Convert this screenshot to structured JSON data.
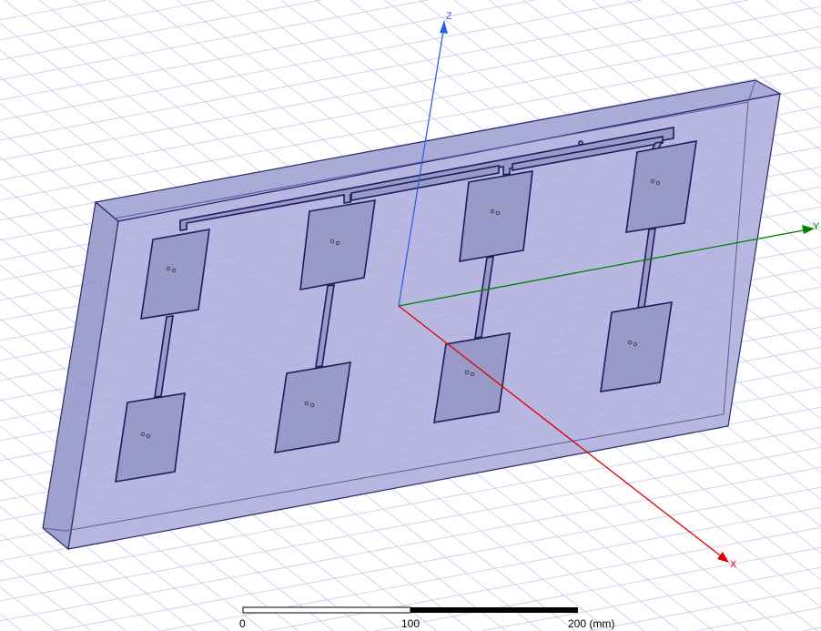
{
  "viewport": {
    "axes": {
      "x_label": "X",
      "y_label": "Y",
      "z_label": "Z",
      "x_color": "#e00000",
      "y_color": "#008000",
      "z_color": "#3060e0"
    },
    "colors": {
      "substrate": "#a8a8d8",
      "patch": "#9a9ac8",
      "outline": "#1c1c5c",
      "grid": "#c8c8e8"
    }
  },
  "scale_bar": {
    "label_0": "0",
    "label_100": "100",
    "label_200": "200 (mm)"
  }
}
